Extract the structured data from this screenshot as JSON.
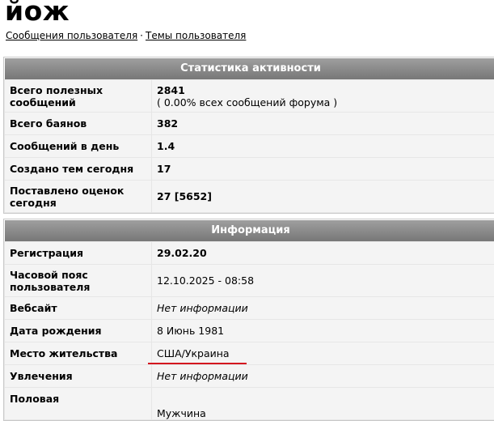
{
  "profile": {
    "username": "йож",
    "links": {
      "messages": "Сообщения пользователя",
      "separator": "·",
      "topics": "Темы пользователя"
    }
  },
  "stats": {
    "header": "Статистика активности",
    "rows": [
      {
        "label": "Всего полезных сообщений",
        "value": "2841",
        "sub": "( 0.00% всех сообщений форума )"
      },
      {
        "label": "Всего баянов",
        "value": "382"
      },
      {
        "label": "Сообщений в день",
        "value": "1.4"
      },
      {
        "label": "Создано тем сегодня",
        "value": "17"
      },
      {
        "label": "Поставлено оценок сегодня",
        "value": "27 [5652]"
      }
    ]
  },
  "info": {
    "header": "Информация",
    "rows": [
      {
        "label": "Регистрация",
        "value": "29.02.20"
      },
      {
        "label": "Часовой пояс пользователя",
        "value": "12.10.2025 - 08:58"
      },
      {
        "label": "Вебсайт",
        "value": "Нет информации"
      },
      {
        "label": "Дата рождения",
        "value": "8 Июнь 1981"
      },
      {
        "label": "Место жительства",
        "value": "США/Украина"
      },
      {
        "label": "Увлечения",
        "value": "Нет информации"
      },
      {
        "label": "Половая",
        "value": "Мужчина"
      }
    ]
  },
  "colors": {
    "header_gradient_top": "#9f9f9f",
    "header_gradient_bottom": "#777777",
    "annotation_underline": "#d4141f"
  }
}
